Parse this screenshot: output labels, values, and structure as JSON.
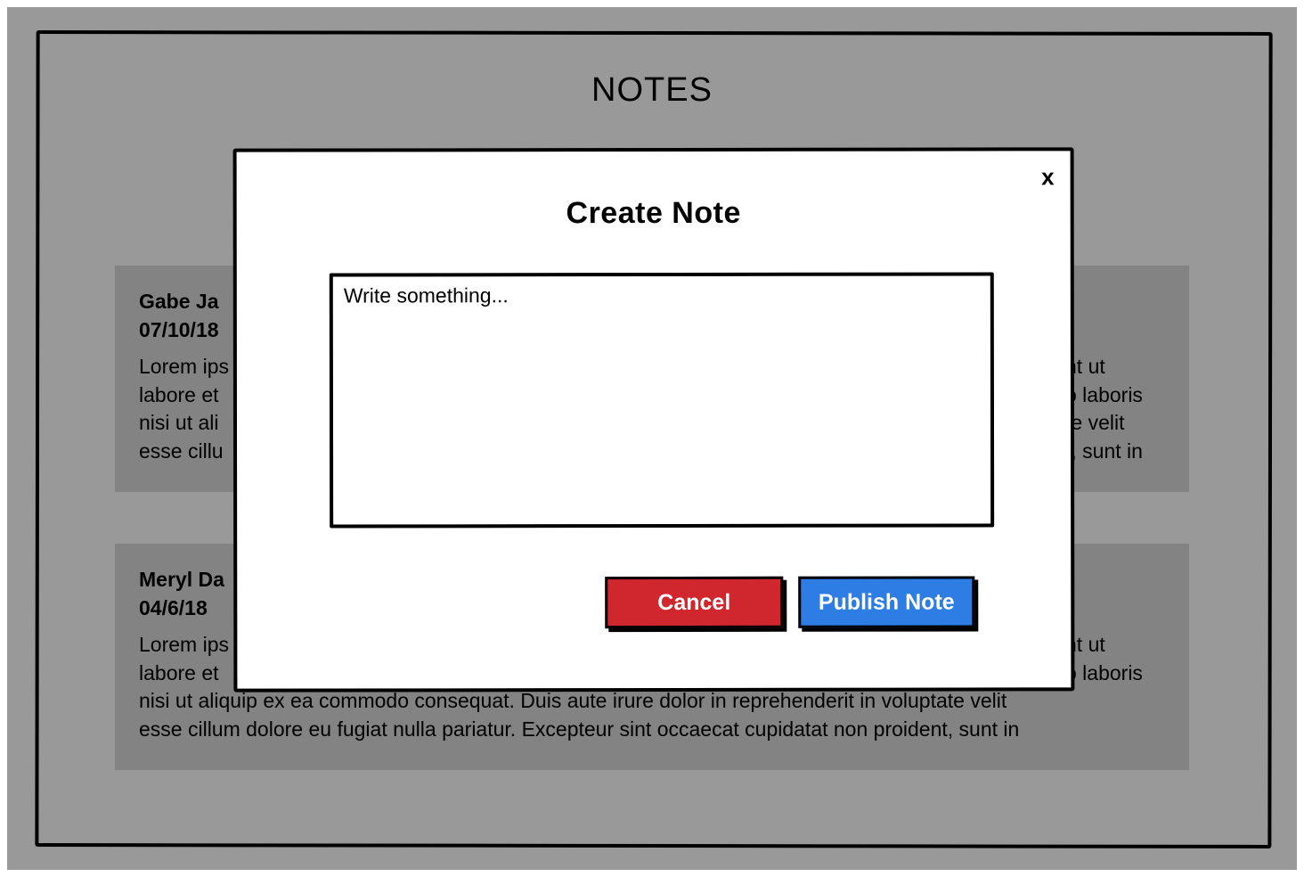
{
  "page": {
    "title": "NOTES"
  },
  "notes": [
    {
      "author": "Gabe Ja",
      "date": "07/10/18",
      "body_left_lines": [
        "Lorem ips",
        "labore et",
        "nisi ut ali",
        "esse cillu"
      ],
      "body_right_lines": [
        "nt ut",
        "o laboris",
        "te velit",
        "t, sunt in"
      ]
    },
    {
      "author": "Meryl Da",
      "date": "04/6/18",
      "body_left_lines": [
        "Lorem ips",
        "labore et"
      ],
      "body_right_lines": [
        "nt ut",
        "o laboris"
      ],
      "body_full_lines": [
        "nisi ut aliquip ex ea commodo consequat. Duis aute irure dolor in reprehenderit in voluptate velit",
        "esse cillum dolore eu fugiat nulla pariatur. Excepteur sint occaecat cupidatat non proident, sunt in"
      ]
    }
  ],
  "modal": {
    "title": "Create Note",
    "close_label": "x",
    "input_placeholder": "Write something...",
    "cancel_label": "Cancel",
    "publish_label": "Publish Note"
  },
  "colors": {
    "backdrop": "#999999",
    "card": "#838383",
    "cancel": "#d0272f",
    "publish": "#2d7de5"
  },
  "icons": {
    "edit": "pencil-icon"
  }
}
